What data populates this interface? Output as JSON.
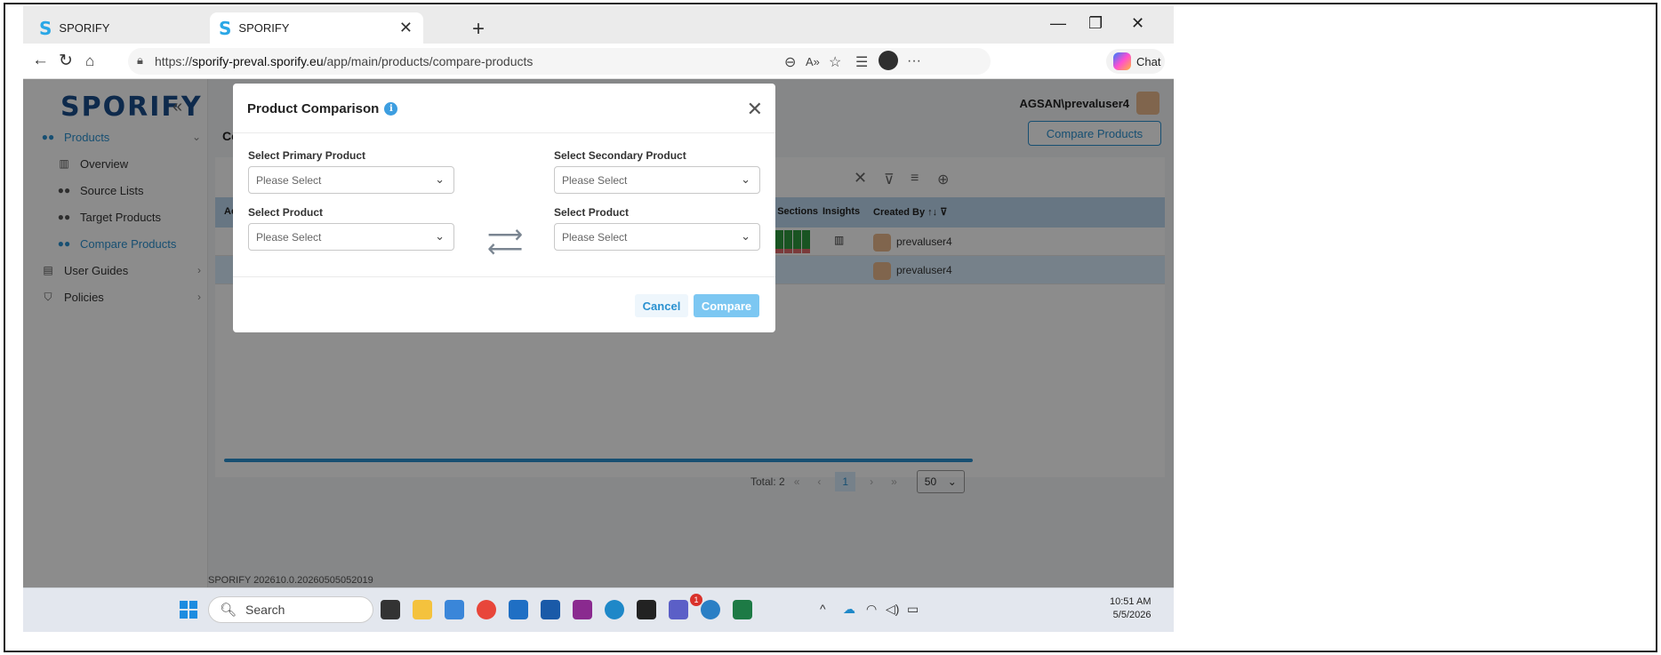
{
  "browser": {
    "tabs": [
      {
        "title": "SPORIFY",
        "favicon": "S"
      },
      {
        "title": "SPORIFY",
        "favicon": "S"
      }
    ],
    "url_prefix": "https://",
    "url_host": "sporify-preval.sporify.eu",
    "url_path": "/app/main/products/compare-products",
    "chat_label": "Chat"
  },
  "app": {
    "logo": "SPORIFY",
    "user": "AGSAN\\prevaluser4",
    "page_title": "Co",
    "compare_button": "Compare Products",
    "sidebar": {
      "products": "Products",
      "sub_items": [
        "Overview",
        "Source Lists",
        "Target Products",
        "Compare Products"
      ],
      "user_guides": "User Guides",
      "policies": "Policies"
    },
    "table": {
      "headers": {
        "first": "Ac",
        "sections": "P Sections",
        "insights": "Insights",
        "created_by": "Created By"
      },
      "rows": [
        {
          "created_by": "prevaluser4"
        },
        {
          "created_by": "prevaluser4"
        }
      ]
    },
    "pager": {
      "total": "Total: 2",
      "current": "1",
      "page_size": "50"
    },
    "version": "SPORIFY 202610.0.20260505052019"
  },
  "modal": {
    "title": "Product Comparison",
    "primary_label": "Select Primary Product",
    "secondary_label": "Select Secondary Product",
    "product_label_left": "Select Product",
    "product_label_right": "Select Product",
    "placeholder": "Please Select",
    "cancel": "Cancel",
    "compare": "Compare"
  },
  "taskbar": {
    "search": "Search",
    "time": "10:51 AM",
    "date": "5/5/2026",
    "notification_count": "1"
  }
}
